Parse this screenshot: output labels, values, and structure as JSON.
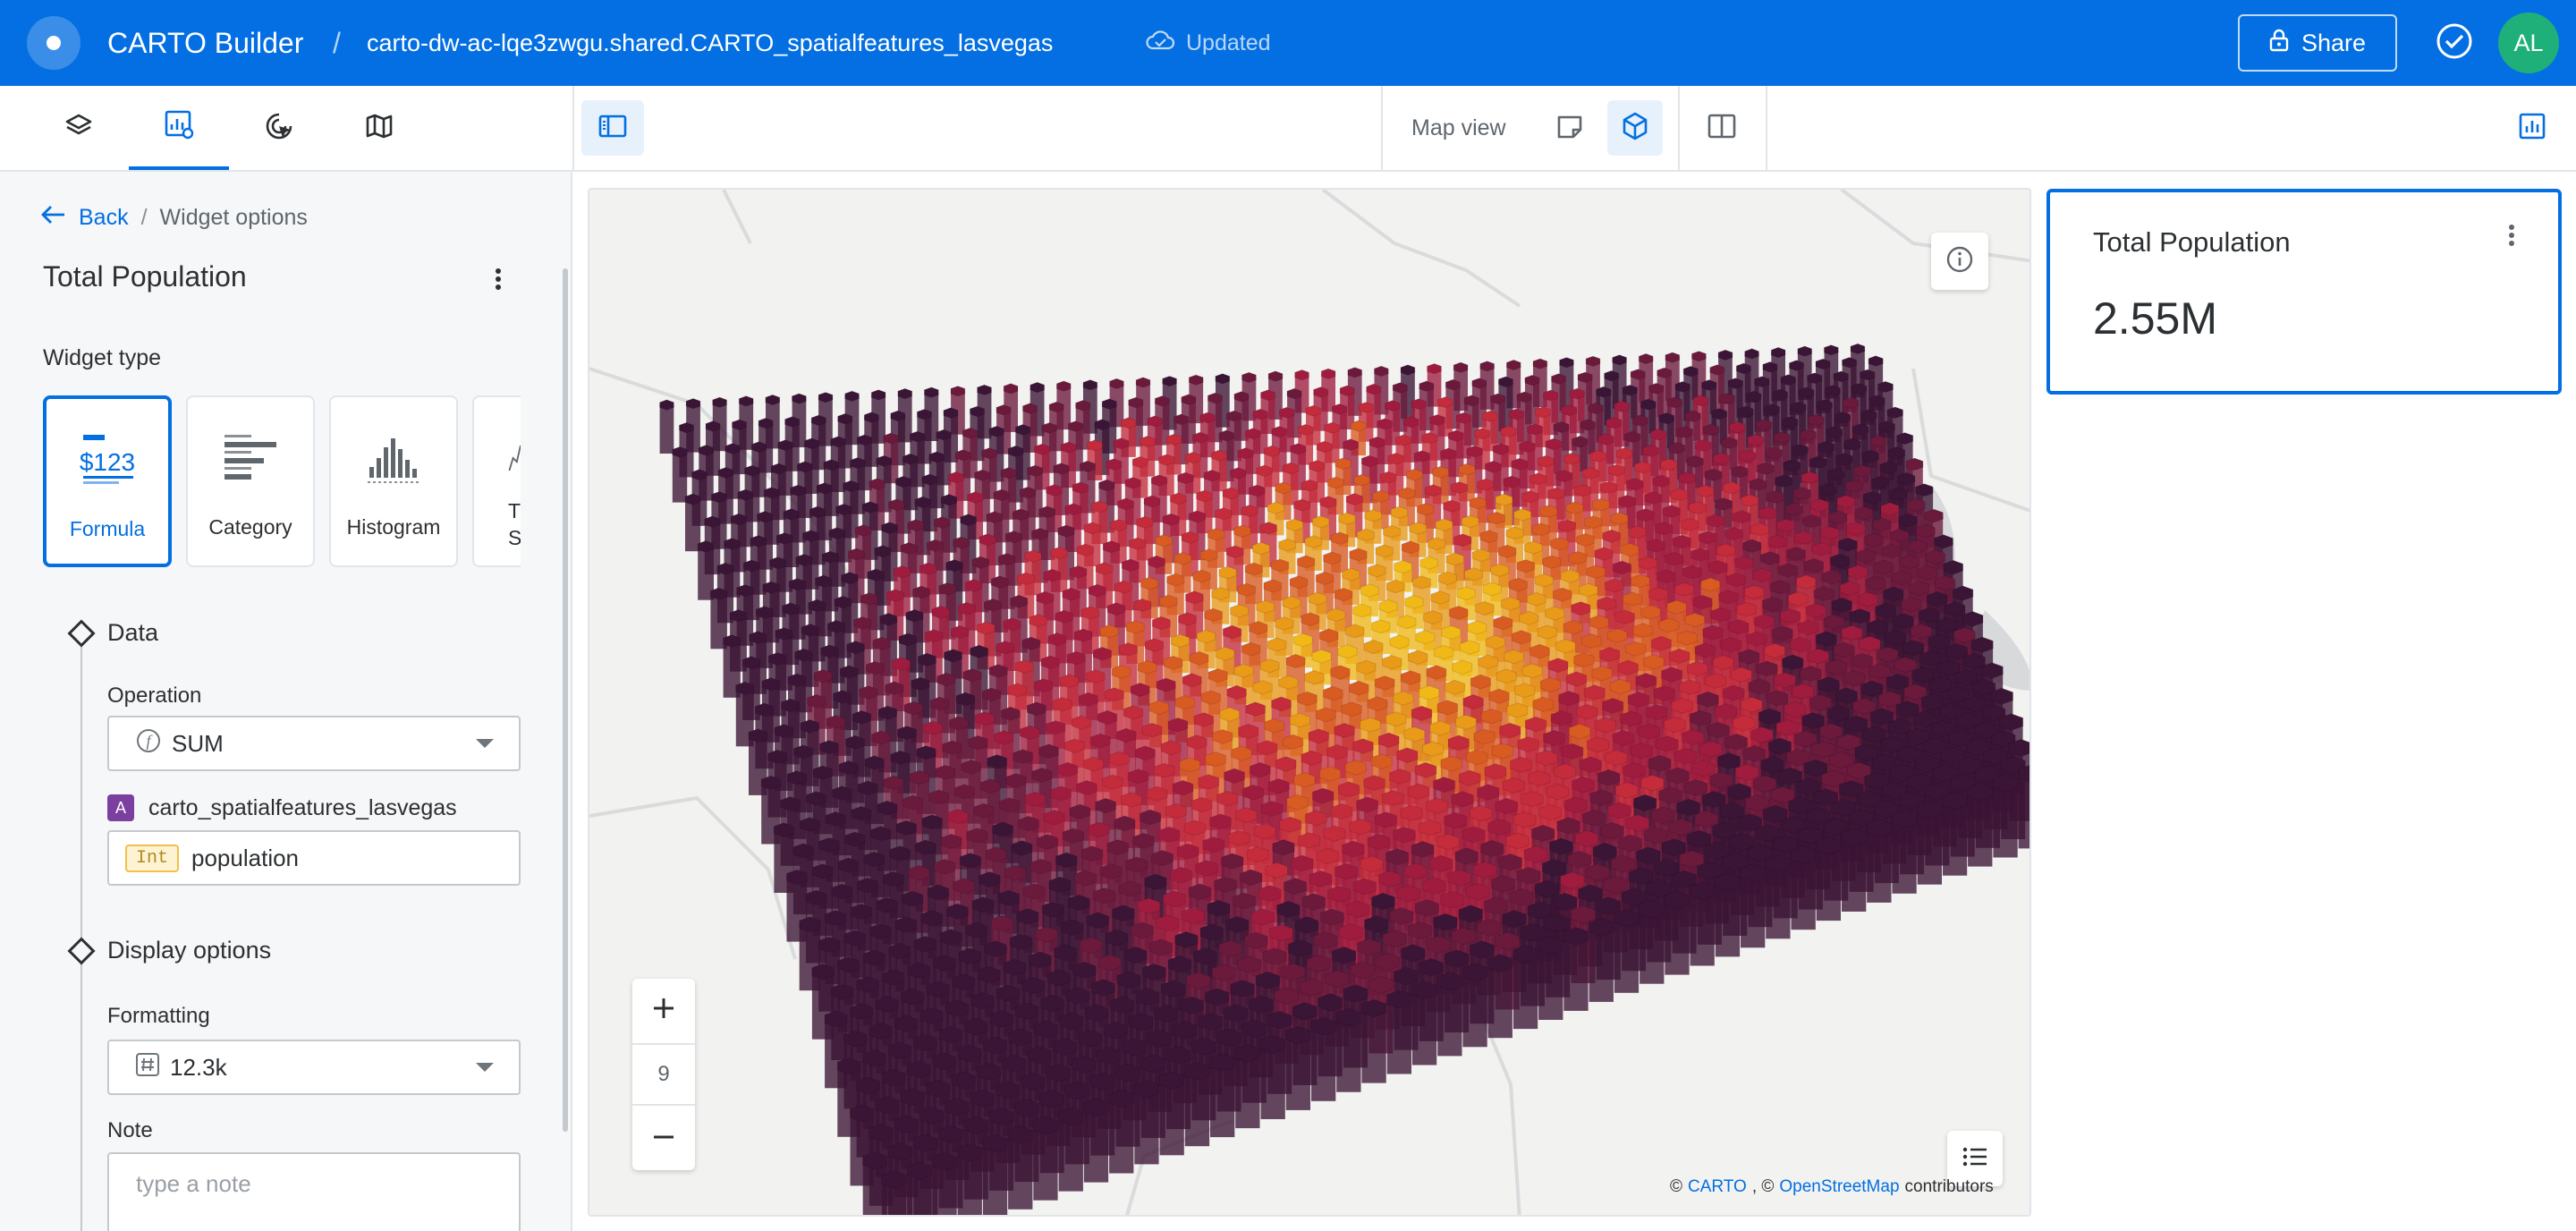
{
  "app": {
    "title": "CARTO Builder",
    "separator": "/",
    "dataset_name": "carto-dw-ac-lqe3zwgu.shared.CARTO_spatialfeatures_lasvegas",
    "sync_status": "Updated",
    "share_label": "Share",
    "user_initials": "AL"
  },
  "toolbar": {
    "tabs": [
      {
        "icon": "layers-icon",
        "active": false
      },
      {
        "icon": "widgets-icon",
        "active": true
      },
      {
        "icon": "interactions-icon",
        "active": false
      },
      {
        "icon": "basemap-icon",
        "active": false
      }
    ],
    "map_view_label": "Map view",
    "map_view_modes": [
      {
        "icon": "map-2d-icon",
        "active": false
      },
      {
        "icon": "map-3d-icon",
        "active": true
      }
    ]
  },
  "left_panel": {
    "back_label": "Back",
    "breadcrumb_sep": "/",
    "breadcrumb_current": "Widget options",
    "widget_title": "Total Population",
    "widget_type_label": "Widget type",
    "widget_types": [
      {
        "label": "Formula",
        "icon": "formula-icon",
        "selected": true
      },
      {
        "label": "Category",
        "icon": "category-icon",
        "selected": false
      },
      {
        "label": "Histogram",
        "icon": "histogram-icon",
        "selected": false
      },
      {
        "label": "Time Series",
        "icon": "time-series-icon",
        "selected": false
      }
    ],
    "data_section": {
      "title": "Data",
      "operation_label": "Operation",
      "operation_value": "SUM",
      "source_badge": "A",
      "source_name": "carto_spatialfeatures_lasvegas",
      "field_type": "Int",
      "field_name": "population"
    },
    "display_section": {
      "title": "Display options",
      "formatting_label": "Formatting",
      "formatting_value": "12.3k",
      "note_label": "Note",
      "note_placeholder": "type a note"
    }
  },
  "map": {
    "zoom_level": "9",
    "attribution": {
      "prefix": "©",
      "carto_link": "CARTO",
      "separator": ", ©",
      "osm_link": "OpenStreetMap",
      "suffix": "contributors"
    },
    "colors": {
      "base": "#f2f2f0",
      "dark": "#3b1535",
      "maroon": "#6b1a3c",
      "crimson": "#a01c3e",
      "red": "#c42b3b",
      "orange": "#d85b22",
      "amber": "#e89a18",
      "yellow": "#f1b917"
    }
  },
  "widget_panel": {
    "title": "Total Population",
    "value": "2.55M"
  },
  "colors": {
    "primary": "#036fe2",
    "avatar": "#1fb07a",
    "source_badge": "#7b3fa0"
  }
}
